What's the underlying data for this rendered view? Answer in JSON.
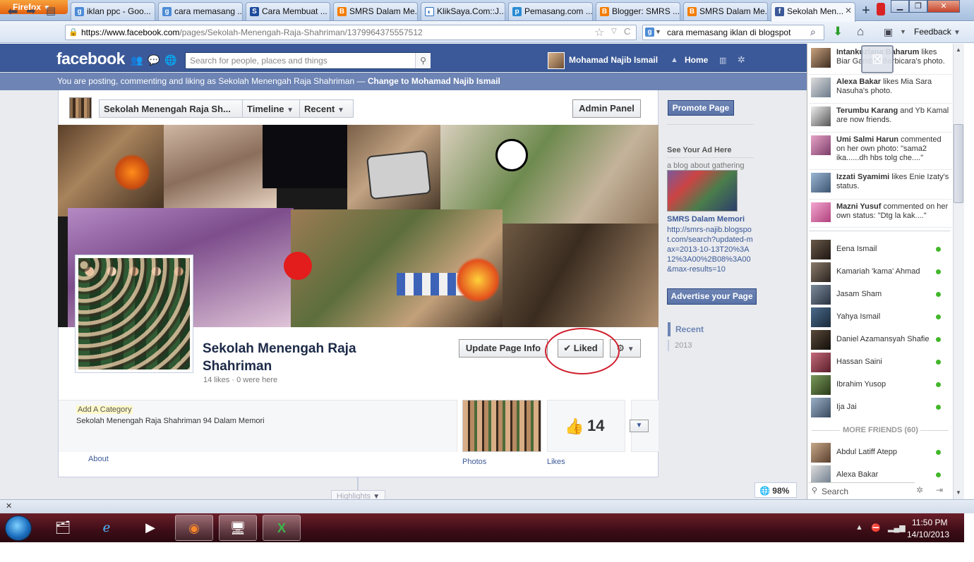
{
  "browser": {
    "menu_label": "Firefox",
    "tabs": [
      {
        "label": "iklan ppc - Goo...",
        "icon": "g"
      },
      {
        "label": "cara memasang ...",
        "icon": "g"
      },
      {
        "label": "Cara Membuat ...",
        "icon": "s"
      },
      {
        "label": "SMRS Dalam Me...",
        "icon": "b"
      },
      {
        "label": "KlikSaya.Com::J...",
        "icon": "k"
      },
      {
        "label": "Pemasang.com ...",
        "icon": "p"
      },
      {
        "label": "Blogger: SMRS ...",
        "icon": "b"
      },
      {
        "label": "SMRS Dalam Me...",
        "icon": "b"
      },
      {
        "label": "Sekolah Men...",
        "icon": "f"
      }
    ],
    "url_domain": "https://www.facebook.com",
    "url_path": "/pages/Sekolah-Menengah-Raja-Shahriman/1379964375557512",
    "search_query": "cara memasang iklan di blogspot",
    "feedback_label": "Feedback"
  },
  "fb_header": {
    "logo": "facebook",
    "search_placeholder": "Search for people, places and things",
    "username": "Mohamad Najib Ismail",
    "home_label": "Home"
  },
  "posting_bar": {
    "text": "You are posting, commenting and liking as Sekolah Menengah Raja Shahriman —",
    "switch_link": "Change to Mohamad Najib Ismail"
  },
  "page_bar": {
    "page_name": "Sekolah Menengah Raja Sh...",
    "timeline_label": "Timeline",
    "recent_label": "Recent",
    "admin_label": "Admin Panel"
  },
  "page": {
    "title": "Sekolah Menengah Raja Shahriman",
    "stats": "14 likes · 0 were here",
    "update_info_label": "Update Page Info",
    "liked_label": "Liked",
    "add_category": "Add A Category",
    "description": "Sekolah Menengah Raja Shahriman 94 Dalam Memori",
    "about_label": "About",
    "photos_label": "Photos",
    "likes_label": "Likes",
    "likes_count": "14",
    "highlights_label": "Highlights"
  },
  "right_column": {
    "promote_label": "Promote Page",
    "see_ad_label": "See Your Ad Here",
    "ad_desc": "a blog about gathering",
    "ad_title": "SMRS Dalam Memori",
    "ad_url": "http://smrs-najib.blogspot.com/search?updated-max=2013-10-13T20%3A12%3A00%2B08%3A00&max-results=10",
    "advertise_label": "Advertise your Page",
    "recent_label": "Recent",
    "year": "2013",
    "zoom": "98%"
  },
  "ticker": [
    {
      "name": "Intankuzlana Baharum",
      "text": "likes Biar Gambar Berbicara's photo."
    },
    {
      "name": "Alexa Bakar",
      "text": "likes Mia Sara Nasuha's photo."
    },
    {
      "name": "Terumbu Karang",
      "text": "and Yb Kamal are now friends."
    },
    {
      "name": "Umi Salmi Harun",
      "text": "commented on her own photo: \"sama2 ika......dh hbs tolg che....\""
    },
    {
      "name": "Izzati Syamimi",
      "text": "likes Enie Izaty's status."
    },
    {
      "name": "Mazni Yusuf",
      "text": "commented on her own status: \"Dtg la kak....\""
    }
  ],
  "friends": [
    "Eena Ismail",
    "Kamariah 'kama' Ahmad",
    "Jasam Sham",
    "Yahya Ismail",
    "Daniel Azamansyah Shafie",
    "Hassan Saini",
    "Ibrahim Yusop",
    "Ija Jai"
  ],
  "more_friends_label": "MORE FRIENDS (60)",
  "more_friends": [
    "Abdul Latiff Atepp",
    "Alexa Bakar"
  ],
  "chat_search_placeholder": "Search",
  "taskbar": {
    "time": "11:50 PM",
    "date": "14/10/2013"
  },
  "colors": {
    "fb_blue": "#3b5998",
    "posting_bar": "#6d84b4",
    "annotation_circle": "#d1202f",
    "online_dot": "#42b72a"
  }
}
